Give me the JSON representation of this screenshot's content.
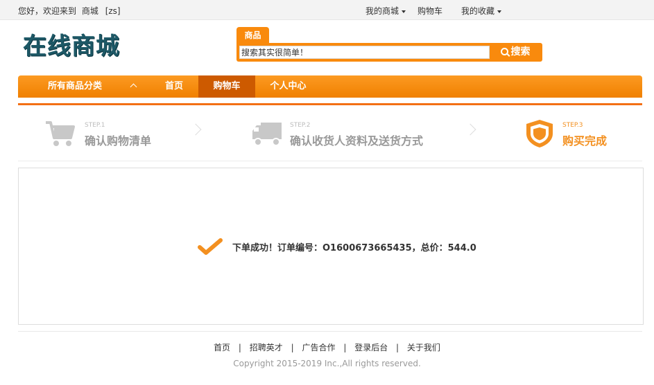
{
  "topbar": {
    "greeting": "您好，欢迎来到",
    "site_name": "商城",
    "username": "[zs]",
    "links": [
      {
        "label": "我的商城",
        "has_dropdown": true
      },
      {
        "label": "购物车",
        "has_dropdown": false
      },
      {
        "label": "我的收藏",
        "has_dropdown": true
      }
    ]
  },
  "header": {
    "logo_text": "在线商城",
    "search": {
      "tab_label": "商品",
      "value": "搜索其实很简单！",
      "button_label": "搜索",
      "button_icon": "search-icon"
    }
  },
  "nav": {
    "category_label": "所有商品分类",
    "items": [
      {
        "label": "首页",
        "active": false
      },
      {
        "label": "购物车",
        "active": true
      },
      {
        "label": "个人中心",
        "active": false
      }
    ]
  },
  "steps": [
    {
      "num": "STEP.1",
      "label": "确认购物清单",
      "icon": "cart-icon",
      "active": false
    },
    {
      "num": "STEP.2",
      "label": "确认收货人资料及送货方式",
      "icon": "truck-icon",
      "active": false
    },
    {
      "num": "STEP.3",
      "label": "购买完成",
      "icon": "shield-icon",
      "active": true
    }
  ],
  "result": {
    "icon": "checkmark-icon",
    "message": "下单成功！订单编号：O1600673665435，总价：544.0"
  },
  "footer": {
    "links": [
      "首页",
      "招聘英才",
      "广告合作",
      "登录后台",
      "关于我们"
    ],
    "separator": "|",
    "copyright": "Copyright 2015-2019 Inc.,All rights reserved."
  },
  "colors": {
    "accent": "#f98a0d",
    "nav_active": "#cd5a00",
    "logo": "#1d5866",
    "step_active": "#f39020"
  }
}
